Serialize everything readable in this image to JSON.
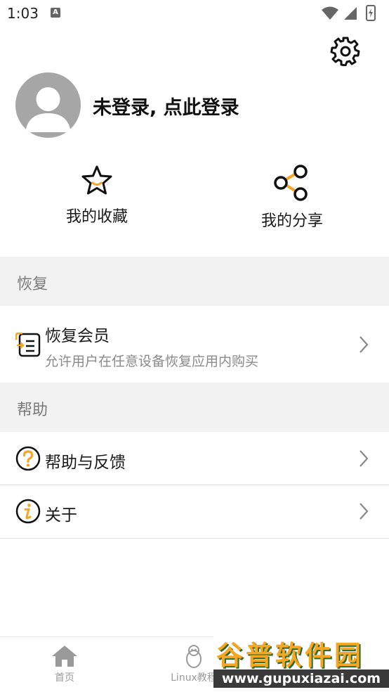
{
  "status_bar": {
    "time": "1:03",
    "notification_icon_letter": "A"
  },
  "profile": {
    "login_text": "未登录, 点此登录"
  },
  "quick_actions": [
    {
      "label": "我的收藏",
      "icon": "star-icon"
    },
    {
      "label": "我的分享",
      "icon": "share-icon"
    }
  ],
  "sections": {
    "restore": {
      "title": "恢复",
      "item": {
        "title": "恢复会员",
        "subtitle": "允许用户在任意设备恢复应用内购买",
        "icon": "restore-icon"
      }
    },
    "help": {
      "title": "帮助",
      "items": [
        {
          "title": "帮助与反馈",
          "icon": "question-icon"
        },
        {
          "title": "关于",
          "icon": "info-icon"
        }
      ]
    }
  },
  "bottom_nav": [
    {
      "label": "首页",
      "icon": "home-icon"
    },
    {
      "label": "Linux教程",
      "icon": "linux-penguin-icon"
    }
  ],
  "watermark": {
    "title": "谷普软件园",
    "url": "www.gupuxiazai.com"
  },
  "colors": {
    "accent": "#f5a623",
    "section_bg": "#f2f2f2",
    "avatar": "#a6a6a6"
  }
}
